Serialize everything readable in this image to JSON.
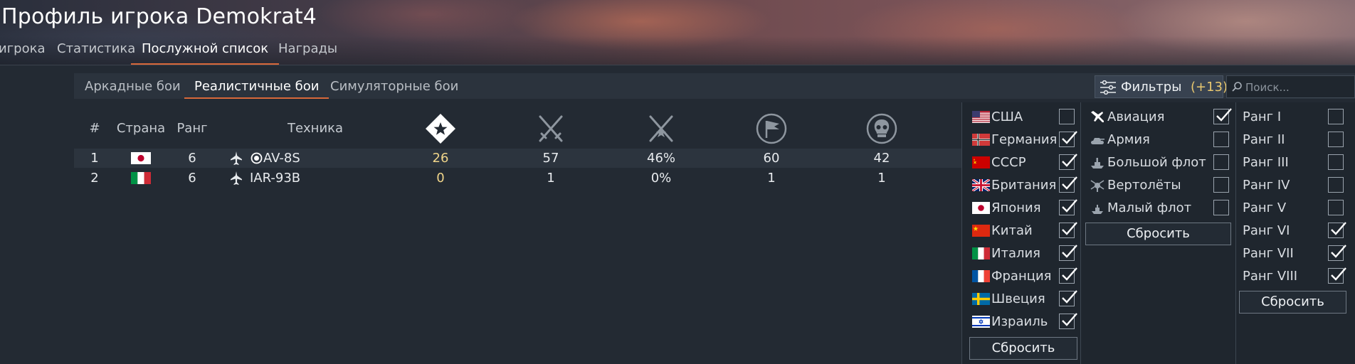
{
  "header": {
    "title": "Профиль игрока Demokrat4",
    "tabs": [
      {
        "label": "игрока",
        "active": false
      },
      {
        "label": "Статистика",
        "active": false
      },
      {
        "label": "Послужной список",
        "active": true
      },
      {
        "label": "Награды",
        "active": false
      }
    ]
  },
  "mode_tabs": [
    {
      "label": "Аркадные бои",
      "active": false
    },
    {
      "label": "Реалистичные бои",
      "active": true
    },
    {
      "label": "Симуляторные бои",
      "active": false
    }
  ],
  "filters_button": {
    "label": "Фильтры",
    "count": "(+13)"
  },
  "search": {
    "placeholder": "Поиск..."
  },
  "table": {
    "columns": {
      "num": "#",
      "country": "Страна",
      "rank": "Ранг",
      "vehicle": "Техника"
    },
    "icon_columns": [
      "victories-icon",
      "battles-icon",
      "win-rate-icon",
      "missions-icon",
      "kills-icon"
    ],
    "rows": [
      {
        "num": "1",
        "country": "japan",
        "rank": "6",
        "vehicle": "AV-8S",
        "premium_marker": true,
        "victories": "26",
        "battles": "57",
        "win_rate": "46%",
        "missions": "60",
        "kills": "42"
      },
      {
        "num": "2",
        "country": "italy",
        "rank": "6",
        "vehicle": "IAR-93B",
        "premium_marker": false,
        "victories": "0",
        "battles": "1",
        "win_rate": "0%",
        "missions": "1",
        "kills": "1"
      }
    ]
  },
  "filter_panel": {
    "countries": [
      {
        "label": "США",
        "flag": "usa",
        "checked": false
      },
      {
        "label": "Германия",
        "flag": "germany",
        "checked": true
      },
      {
        "label": "СССР",
        "flag": "ussr",
        "checked": true
      },
      {
        "label": "Британия",
        "flag": "britain",
        "checked": true
      },
      {
        "label": "Япония",
        "flag": "japan",
        "checked": true
      },
      {
        "label": "Китай",
        "flag": "china",
        "checked": true
      },
      {
        "label": "Италия",
        "flag": "italy",
        "checked": true
      },
      {
        "label": "Франция",
        "flag": "france",
        "checked": true
      },
      {
        "label": "Швеция",
        "flag": "sweden",
        "checked": true
      },
      {
        "label": "Израиль",
        "flag": "israel",
        "checked": true
      }
    ],
    "countries_reset": "Сбросить",
    "types": [
      {
        "label": "Авиация",
        "icon": "aircraft-icon",
        "checked": true
      },
      {
        "label": "Армия",
        "icon": "tank-icon",
        "checked": false
      },
      {
        "label": "Большой флот",
        "icon": "bluewater-fleet-icon",
        "checked": false
      },
      {
        "label": "Вертолёты",
        "icon": "helicopter-icon",
        "checked": false
      },
      {
        "label": "Малый флот",
        "icon": "coastal-fleet-icon",
        "checked": false
      }
    ],
    "types_reset": "Сбросить",
    "ranks": [
      {
        "label": "Ранг I",
        "checked": false
      },
      {
        "label": "Ранг II",
        "checked": false
      },
      {
        "label": "Ранг III",
        "checked": false
      },
      {
        "label": "Ранг IV",
        "checked": false
      },
      {
        "label": "Ранг V",
        "checked": false
      },
      {
        "label": "Ранг VI",
        "checked": true
      },
      {
        "label": "Ранг VII",
        "checked": true
      },
      {
        "label": "Ранг VIII",
        "checked": true
      }
    ],
    "ranks_reset": "Сбросить"
  }
}
